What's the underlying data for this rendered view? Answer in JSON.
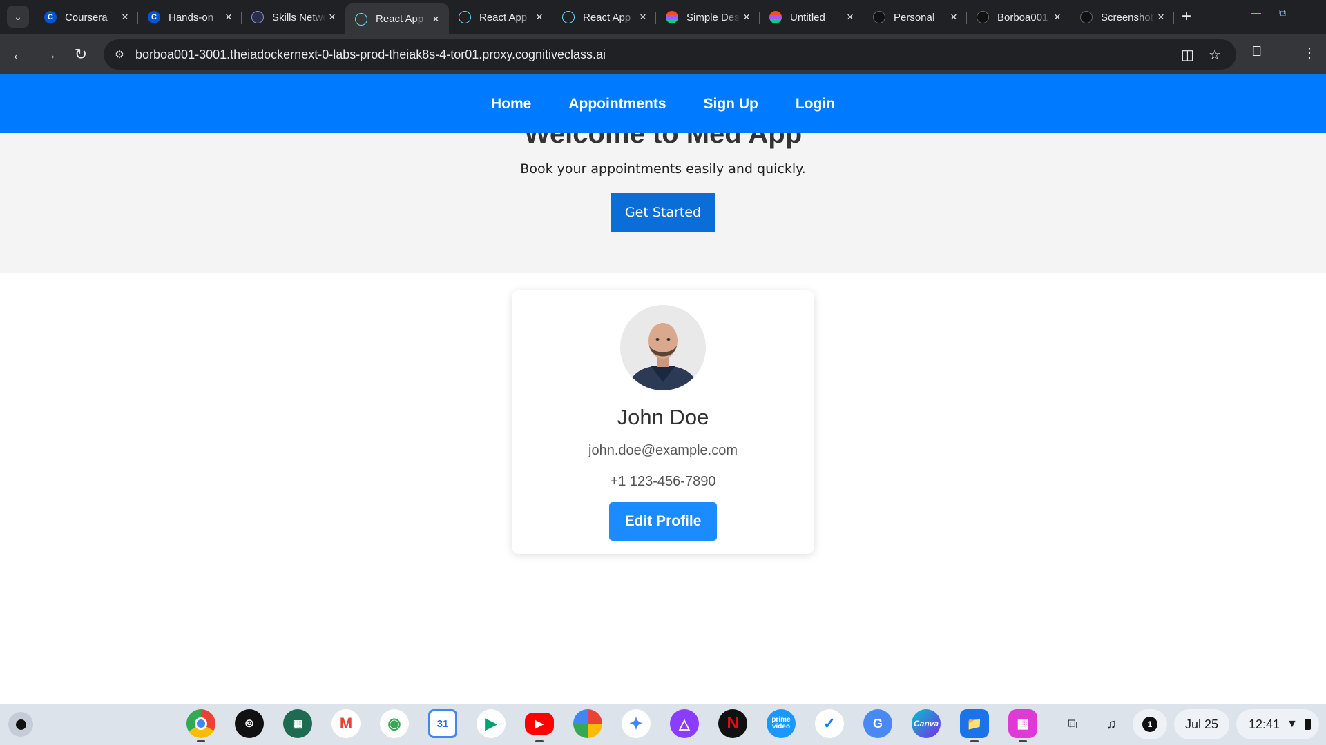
{
  "browser": {
    "tabs": [
      {
        "title": "Coursera",
        "icon": "coursera-icon",
        "active": false
      },
      {
        "title": "Hands-on",
        "icon": "coursera-icon",
        "active": false
      },
      {
        "title": "Skills Network",
        "icon": "skills-network-icon",
        "active": false
      },
      {
        "title": "React App",
        "icon": "react-icon",
        "active": true
      },
      {
        "title": "React App",
        "icon": "react-icon",
        "active": false
      },
      {
        "title": "React App",
        "icon": "react-icon",
        "active": false
      },
      {
        "title": "Simple Design",
        "icon": "figma-icon",
        "active": false
      },
      {
        "title": "Untitled",
        "icon": "figma-icon",
        "active": false
      },
      {
        "title": "Personal",
        "icon": "github-icon",
        "active": false
      },
      {
        "title": "Borboa001",
        "icon": "github-icon",
        "active": false
      },
      {
        "title": "Screenshot",
        "icon": "github-icon",
        "active": false
      }
    ],
    "url": "borboa001-3001.theiadockernext-0-labs-prod-theiak8s-4-tor01.proxy.cognitiveclass.ai"
  },
  "page": {
    "nav": {
      "home": "Home",
      "appointments": "Appointments",
      "signup": "Sign Up",
      "login": "Login"
    },
    "hero": {
      "title": "Welcome to Med App",
      "subtitle": "Book your appointments easily and quickly.",
      "button": "Get Started"
    },
    "profile": {
      "name": "John Doe",
      "email": "john.doe@example.com",
      "phone": "+1 123-456-7890",
      "edit_button": "Edit Profile"
    },
    "colors": {
      "navbar": "#007bff",
      "hero_button": "#0a6dd8",
      "edit_button": "#1a8cff"
    }
  },
  "shelf": {
    "apps": [
      "chrome-icon",
      "podcasts-icon",
      "workspace-icon",
      "gmail-icon",
      "maps-icon",
      "calendar-icon",
      "play-store-icon",
      "youtube-icon",
      "photos-icon",
      "gemini-icon",
      "proton-icon",
      "netflix-icon",
      "prime-video-icon",
      "messenger-icon",
      "translate-icon",
      "canva-icon",
      "files-icon",
      "screenshot-app-icon"
    ],
    "calendar_day": "31",
    "prime_label": "prime video",
    "canva_label": "Canva",
    "notification_count": "1",
    "date": "Jul 25",
    "time": "12:41"
  }
}
